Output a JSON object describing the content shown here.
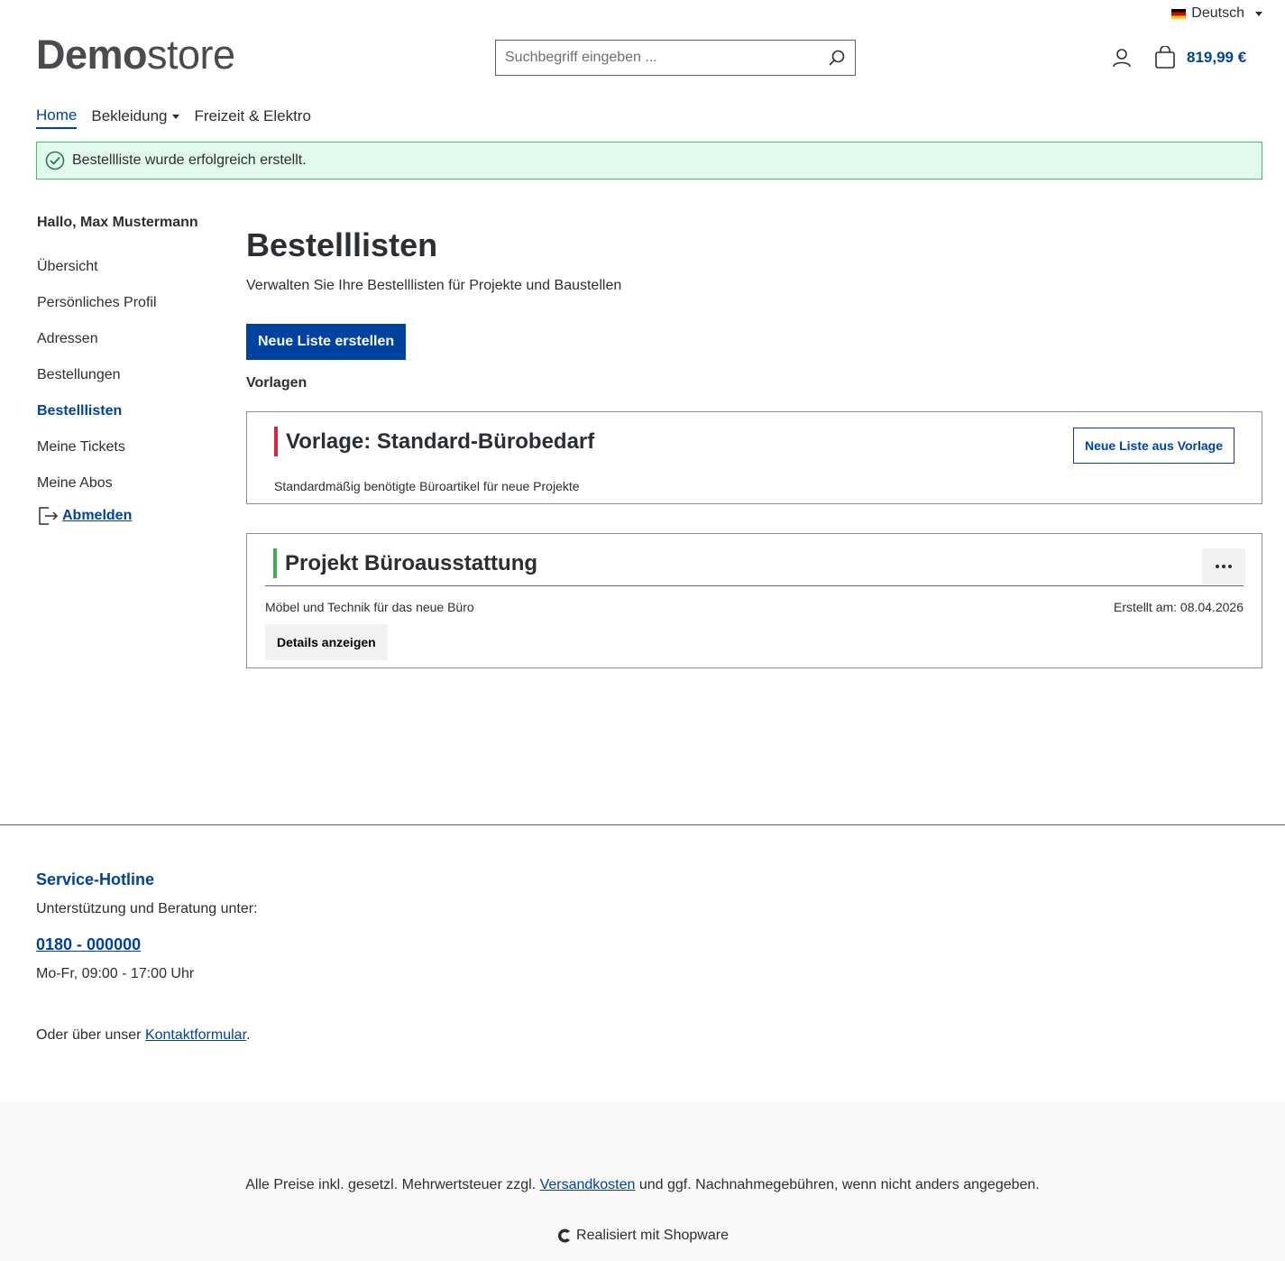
{
  "header": {
    "language": "Deutsch",
    "logo": {
      "bold": "Demo",
      "light": "store"
    },
    "search_placeholder": "Suchbegriff eingeben ...",
    "cart_total": "819,99 €"
  },
  "nav": {
    "items": [
      {
        "label": "Home",
        "active": true
      },
      {
        "label": "Bekleidung",
        "dropdown": true
      },
      {
        "label": "Freizeit & Elektro"
      }
    ]
  },
  "alert": {
    "message": "Bestellliste wurde erfolgreich erstellt."
  },
  "sidebar": {
    "greeting": "Hallo, Max Mustermann",
    "items": [
      {
        "label": "Übersicht"
      },
      {
        "label": "Persönliches Profil"
      },
      {
        "label": "Adressen"
      },
      {
        "label": "Bestellungen"
      },
      {
        "label": "Bestelllisten",
        "active": true
      },
      {
        "label": "Meine Tickets"
      },
      {
        "label": "Meine Abos"
      }
    ],
    "logout": "Abmelden"
  },
  "main": {
    "title": "Bestelllisten",
    "lead": "Verwalten Sie Ihre Bestelllisten für Projekte und Baustellen",
    "new_list_button": "Neue Liste erstellen",
    "templates_label": "Vorlagen",
    "template_card": {
      "title": "Vorlage: Standard-Bürobedarf",
      "description": "Standardmäßig benötigte Büroartikel für neue Projekte",
      "button": "Neue Liste aus Vorlage"
    },
    "list_card": {
      "title": "Projekt Büroausstattung",
      "description": "Möbel und Technik für das neue Büro",
      "created": "Erstellt am: 08.04.2026",
      "details_button": "Details anzeigen"
    }
  },
  "footer": {
    "hotline_title": "Service-Hotline",
    "support_text": "Unterstützung und Beratung unter:",
    "phone": "0180 - 000000",
    "hours": "Mo-Fr, 09:00 - 17:00 Uhr",
    "contact_prefix": "Oder über unser ",
    "contact_link": "Kontaktformular",
    "contact_suffix": ".",
    "vat_prefix": "Alle Preise inkl. gesetzl. Mehrwertsteuer zzgl. ",
    "vat_link": "Versandkosten",
    "vat_suffix": " und ggf. Nachnahmegebühren, wenn nicht anders angegeben.",
    "powered_by": "Realisiert mit Shopware"
  },
  "colors": {
    "accent": "#0042a0",
    "success_bg": "#e2f9ee",
    "success_border": "#3cc261",
    "template_bar": "#d7263d",
    "list_bar": "#3cae4e"
  }
}
